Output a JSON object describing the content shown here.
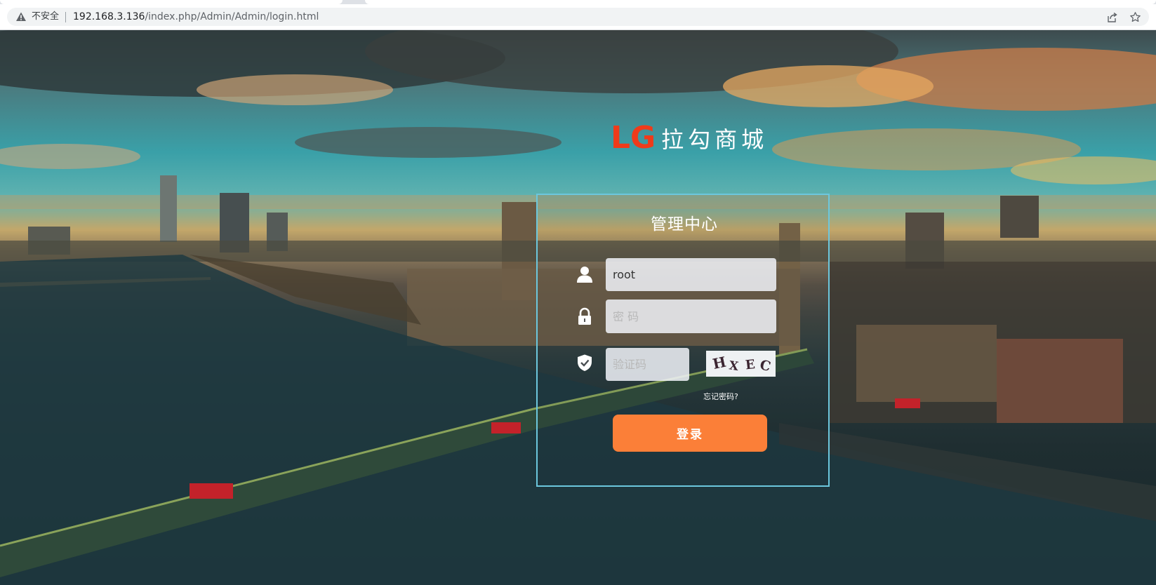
{
  "browser": {
    "security_label": "不安全",
    "url_host": "192.168.3.136",
    "url_path": "/index.php/Admin/Admin/login.html"
  },
  "brand": {
    "logo_mark": "LG",
    "name": "拉勾商城",
    "logo_mark_color": "#ef3b1a"
  },
  "login": {
    "title": "管理中心",
    "username": {
      "value": "root",
      "icon": "user-icon"
    },
    "password": {
      "placeholder": "密 码",
      "icon": "lock-icon"
    },
    "captcha": {
      "placeholder": "验证码",
      "icon": "shield-check-icon",
      "image_text": "HXEC"
    },
    "forgot_label": "忘记密码?",
    "submit_label": "登录",
    "submit_color": "#fb7f38",
    "panel_border_color": "#6cc7dd"
  }
}
